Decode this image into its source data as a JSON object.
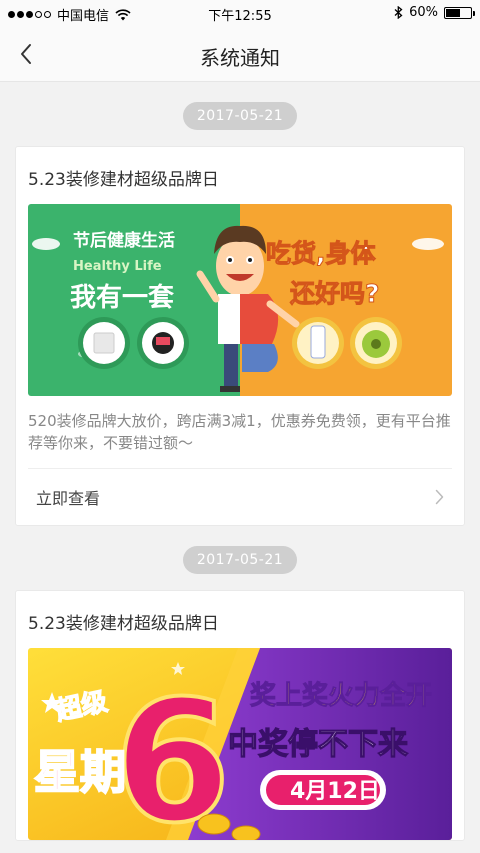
{
  "status_bar": {
    "carrier": "中国电信",
    "time": "下午12:55",
    "battery_pct": "60%",
    "battery_level": 0.6,
    "signal_bars_filled": 3
  },
  "nav": {
    "title": "系统通知",
    "back_icon": "chevron-left-icon"
  },
  "notifications": [
    {
      "date": "2017-05-21",
      "title": "5.23装修建材超级品牌日",
      "banner": {
        "left_line1": "节后健康生活",
        "left_line2": "Healthy Life",
        "left_line3": "我有一套",
        "right_line1": "吃货,身体",
        "right_line2": "还好吗?",
        "left_color": "#3bb36c",
        "right_color": "#f6a531"
      },
      "description": "520装修品牌大放价，跨店满3减1，优惠券免费领，更有平台推荐等你来，不要错过额～",
      "action_label": "立即查看"
    },
    {
      "date": "2017-05-21",
      "title": "5.23装修建材超级品牌日",
      "banner": {
        "left_line1": "超级",
        "left_line2": "星期",
        "left_num": "6",
        "right_line1": "奖上奖火力全开",
        "right_line2": "中奖停不下来",
        "date_badge": "4月12日",
        "left_color": "#f7c21c",
        "right_color": "#7a2fb8"
      }
    }
  ]
}
